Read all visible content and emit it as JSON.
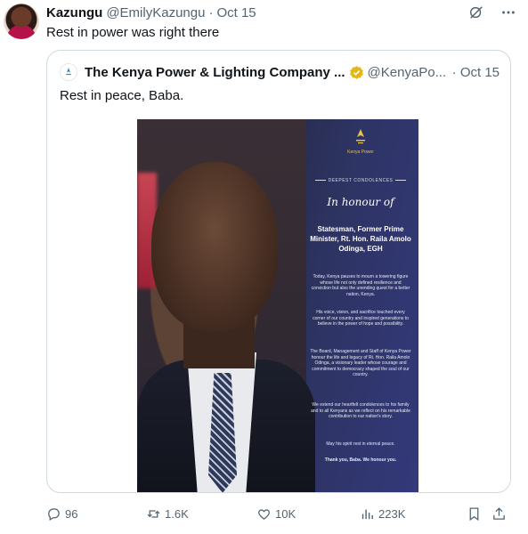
{
  "tweet": {
    "author_name": "Kazungu",
    "author_handle": "@EmilyKazungu",
    "separator": "·",
    "date": "Oct 15",
    "text": "Rest in power was right there"
  },
  "quoted": {
    "author_name": "The Kenya Power & Lighting Company ...",
    "author_handle": "@KenyaPo...",
    "separator": "·",
    "date": "Oct 15",
    "text": "Rest in peace, Baba.",
    "poster": {
      "brand": "Kenya Power",
      "heading": "DEEPEST CONDOLENCES",
      "honour": "In honour of",
      "title": "Statesman, Former Prime Minister, Rt. Hon. Raila Amolo Odinga, EGH",
      "paragraphs": [
        "Today, Kenya pauses to mourn a towering figure whose life not only defined resilience and conviction but also the unending quest for a better nation, Kenya.",
        "His voice, vision, and sacrifice touched every corner of our country and inspired generations to believe in the power of hope and possibility.",
        "The Board, Management and Staff of Kenya Power honour the life and legacy of Rt. Hon. Raila Amolo Odinga, a visionary leader whose courage and commitment to democracy shaped the soul of our country.",
        "We extend our heartfelt condolences to his family and to all Kenyans as we reflect on his remarkable contribution to our nation's story.",
        "May his spirit rest in eternal peace.",
        "Thank you, Baba. We honour you."
      ]
    }
  },
  "actions": {
    "replies": "96",
    "retweets": "1.6K",
    "likes": "10K",
    "views": "223K"
  },
  "colors": {
    "text": "#0f1419",
    "muted": "#536471",
    "border": "#cfd9de",
    "verified_gold": "#e2b719"
  }
}
